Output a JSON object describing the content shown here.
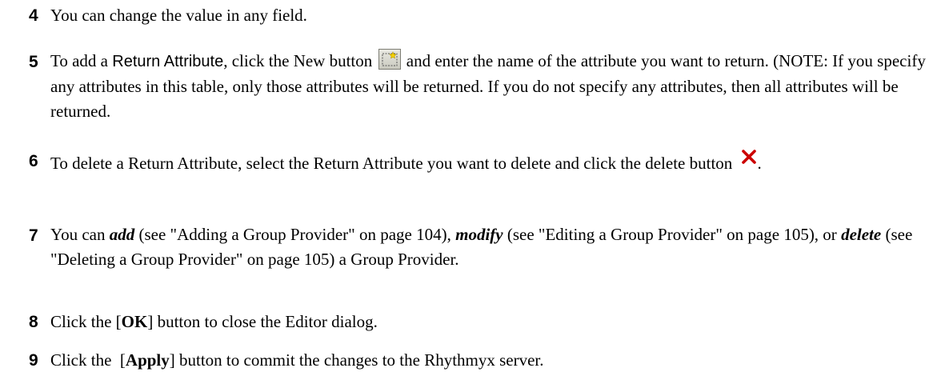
{
  "steps": [
    {
      "number": "4",
      "text": "You can change the value in any field."
    },
    {
      "number": "5",
      "pre": "To add a ",
      "term": "Return Attribute",
      "mid": ", click the New button",
      "icon": "new-button-icon",
      "post": "and enter the name of the attribute you want to return.  (NOTE:  If you specify any attributes in this table, only those attributes will be returned.  If you do not specify any attributes, then all attributes will be returned."
    },
    {
      "number": "6",
      "text": "To delete a Return Attribute, select the Return Attribute you want to delete and click the delete button",
      "icon": "delete-x-icon",
      "post": "."
    },
    {
      "number": "7",
      "t1": "You can ",
      "add": "add",
      "t2": " (see \"Adding a Group Provider\" on page 104), ",
      "modify": "modify",
      "t3": " (see \"Editing a Group Provider\" on page 105), or ",
      "delete": "delete",
      "t4": " (see \"Deleting a Group Provider\" on page 105) a Group Provider."
    },
    {
      "number": "8",
      "pre": "Click the [",
      "bold": "OK",
      "post": "] button to close the Editor dialog."
    },
    {
      "number": "9",
      "pre": "Click the  [",
      "bold": "Apply",
      "post": "] button to commit the changes to the Rhythmyx server."
    }
  ],
  "colors": {
    "text": "#000000",
    "delete_icon": "#cc0000",
    "new_icon_face": "#d6d6cc"
  }
}
